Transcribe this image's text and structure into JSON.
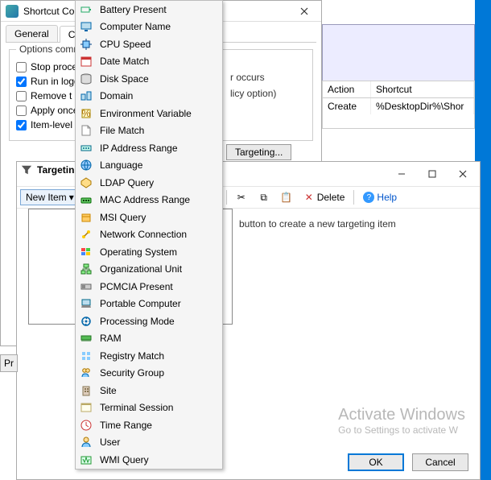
{
  "dlg1": {
    "title": "Shortcut Control",
    "tabs": {
      "general": "General",
      "common": "Common"
    },
    "group_label": "Options common",
    "checks": {
      "stop": "Stop processing",
      "loggedon": "Run in logged-on",
      "remove": "Remove t",
      "applyonce": "Apply once",
      "itemlevel": "Item-level"
    },
    "frag1": "r occurs",
    "frag2": "licy option)",
    "targeting_btn": "Targeting..."
  },
  "grid": {
    "hdr_action": "Action",
    "hdr_shortcut": "Shortcut",
    "row": {
      "action": "Create",
      "shortcut": "%DesktopDir%\\Shor"
    }
  },
  "dlg2": {
    "targeting_label": "Targeting",
    "newitem": "New Item",
    "delete": "Delete",
    "help": "Help",
    "hint": "button to create a new targeting item",
    "ok": "OK",
    "cancel": "Cancel",
    "p": "Pr"
  },
  "watermark": {
    "title": "Activate Windows",
    "sub": "Go to Settings to activate W"
  },
  "menu": [
    {
      "name": "battery-present",
      "label": "Battery Present"
    },
    {
      "name": "computer-name",
      "label": "Computer Name"
    },
    {
      "name": "cpu-speed",
      "label": "CPU Speed"
    },
    {
      "name": "date-match",
      "label": "Date Match"
    },
    {
      "name": "disk-space",
      "label": "Disk Space"
    },
    {
      "name": "domain",
      "label": "Domain"
    },
    {
      "name": "environment-variable",
      "label": "Environment Variable"
    },
    {
      "name": "file-match",
      "label": "File Match"
    },
    {
      "name": "ip-address-range",
      "label": "IP Address Range"
    },
    {
      "name": "language",
      "label": "Language"
    },
    {
      "name": "ldap-query",
      "label": "LDAP Query"
    },
    {
      "name": "mac-address-range",
      "label": "MAC Address Range"
    },
    {
      "name": "msi-query",
      "label": "MSI Query"
    },
    {
      "name": "network-connection",
      "label": "Network Connection"
    },
    {
      "name": "operating-system",
      "label": "Operating System"
    },
    {
      "name": "organizational-unit",
      "label": "Organizational Unit"
    },
    {
      "name": "pcmcia-present",
      "label": "PCMCIA Present"
    },
    {
      "name": "portable-computer",
      "label": "Portable Computer"
    },
    {
      "name": "processing-mode",
      "label": "Processing Mode"
    },
    {
      "name": "ram",
      "label": "RAM"
    },
    {
      "name": "registry-match",
      "label": "Registry Match"
    },
    {
      "name": "security-group",
      "label": "Security Group"
    },
    {
      "name": "site",
      "label": "Site"
    },
    {
      "name": "terminal-session",
      "label": "Terminal Session"
    },
    {
      "name": "time-range",
      "label": "Time Range"
    },
    {
      "name": "user",
      "label": "User"
    },
    {
      "name": "wmi-query",
      "label": "WMI Query"
    }
  ]
}
